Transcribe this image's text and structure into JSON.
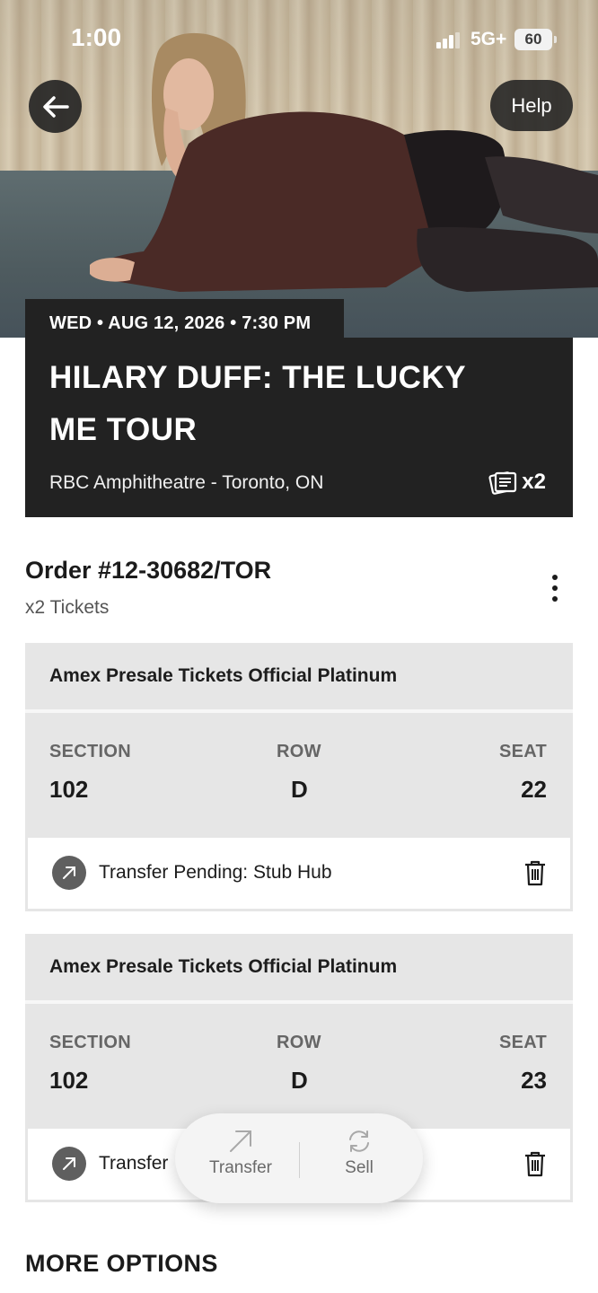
{
  "status_bar": {
    "time": "1:00",
    "network": "5G+",
    "battery": "60"
  },
  "header": {
    "help_label": "Help"
  },
  "event": {
    "date_line": "WED • AUG 12, 2026 • 7:30 PM",
    "title": "HILARY DUFF: THE LUCKY ME TOUR",
    "venue": "RBC Amphitheatre - Toronto, ON",
    "ticket_count": "x2"
  },
  "order": {
    "title": "Order #12-30682/TOR",
    "subtitle": "x2 Tickets"
  },
  "tickets": [
    {
      "type": "Amex Presale Tickets Official Platinum",
      "section_label": "SECTION",
      "section": "102",
      "row_label": "ROW",
      "row": "D",
      "seat_label": "SEAT",
      "seat": "22",
      "status": "Transfer Pending: Stub Hub"
    },
    {
      "type": "Amex Presale Tickets Official Platinum",
      "section_label": "SECTION",
      "section": "102",
      "row_label": "ROW",
      "row": "D",
      "seat_label": "SEAT",
      "seat": "23",
      "status": "Transfer"
    }
  ],
  "action_pill": {
    "transfer_label": "Transfer",
    "sell_label": "Sell"
  },
  "more_options_label": "MORE OPTIONS"
}
